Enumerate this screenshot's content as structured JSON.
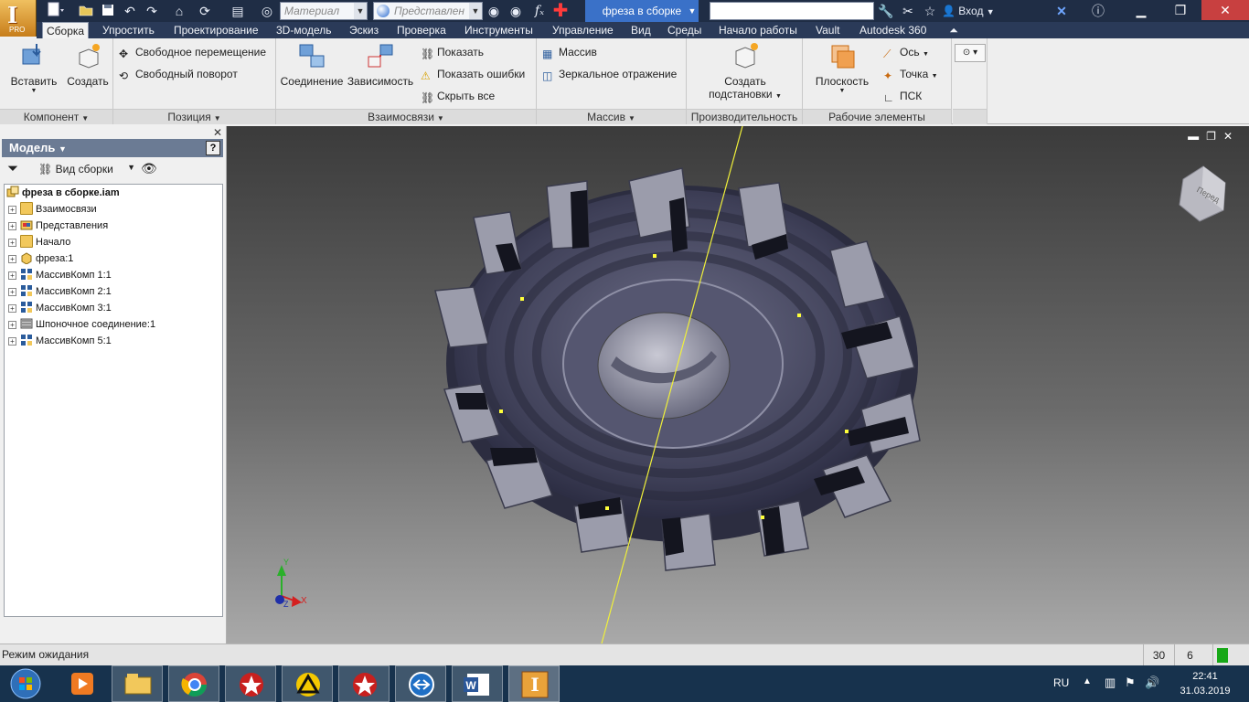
{
  "app": {
    "logo_letter": "I",
    "logo_edition": "PRO",
    "document_tab": "фреза в сборке",
    "material_placeholder": "Материал",
    "appearance_placeholder": "Представлен",
    "sign_in": "Вход"
  },
  "ribbon_tabs": [
    "Сборка",
    "Упростить",
    "Проектирование",
    "3D-модель",
    "Эскиз",
    "Проверка",
    "Инструменты",
    "Управление",
    "Вид",
    "Среды",
    "Начало работы",
    "Vault",
    "Autodesk 360"
  ],
  "ribbon": {
    "component": {
      "insert": "Вставить",
      "create": "Создать",
      "label": "Компонент"
    },
    "position": {
      "free_move": "Свободное перемещение",
      "free_rotate": "Свободный поворот",
      "label": "Позиция"
    },
    "relationships": {
      "joint": "Соединение",
      "constrain": "Зависимость",
      "show": "Показать",
      "show_errors": "Показать ошибки",
      "hide_all": "Скрыть все",
      "label": "Взаимосвязи"
    },
    "pattern": {
      "pattern": "Массив",
      "mirror": "Зеркальное отражение",
      "label": "Массив"
    },
    "productivity": {
      "create_substitutes_line1": "Создать",
      "create_substitutes_line2": "подстановки",
      "label": "Производительность"
    },
    "work_features": {
      "plane": "Плоскость",
      "axis": "Ось",
      "point": "Точка",
      "ucs": "ПСК",
      "label": "Рабочие элементы"
    }
  },
  "browser": {
    "title": "Модель",
    "help": "?",
    "view_label": "Вид сборки",
    "root": "фреза в сборке.iam",
    "items": [
      {
        "label": "Взаимосвязи",
        "icon": "folder-icon"
      },
      {
        "label": "Представления",
        "icon": "representations-icon"
      },
      {
        "label": "Начало",
        "icon": "folder-icon"
      },
      {
        "label": "фреза:1",
        "icon": "part-icon"
      },
      {
        "label": "МассивКомп 1:1",
        "icon": "pattern-icon"
      },
      {
        "label": "МассивКомп 2:1",
        "icon": "pattern-icon"
      },
      {
        "label": "МассивКомп 3:1",
        "icon": "pattern-icon"
      },
      {
        "label": "Шпоночное соединение:1",
        "icon": "key-joint-icon"
      },
      {
        "label": "МассивКомп 5:1",
        "icon": "pattern-icon"
      }
    ]
  },
  "viewport": {
    "viewcube_label": "Перед",
    "axis_x": "X",
    "axis_y": "Y",
    "axis_z": "Z"
  },
  "status": {
    "text": "Режим ожидания",
    "count1": "30",
    "count2": "6"
  },
  "taskbar": {
    "apps": [
      "explorer",
      "media-player",
      "chrome",
      "pokerstars",
      "archicad",
      "pokerstars",
      "teamviewer",
      "word",
      "inventor"
    ],
    "lang": "RU",
    "time": "22:41",
    "date": "31.03.2019"
  },
  "colors": {
    "accent": "#3a71c8",
    "titlebar": "#1f2d45",
    "tabbar": "#2a3a58",
    "taskbar": "#17324d",
    "status_green": "#17a817"
  }
}
